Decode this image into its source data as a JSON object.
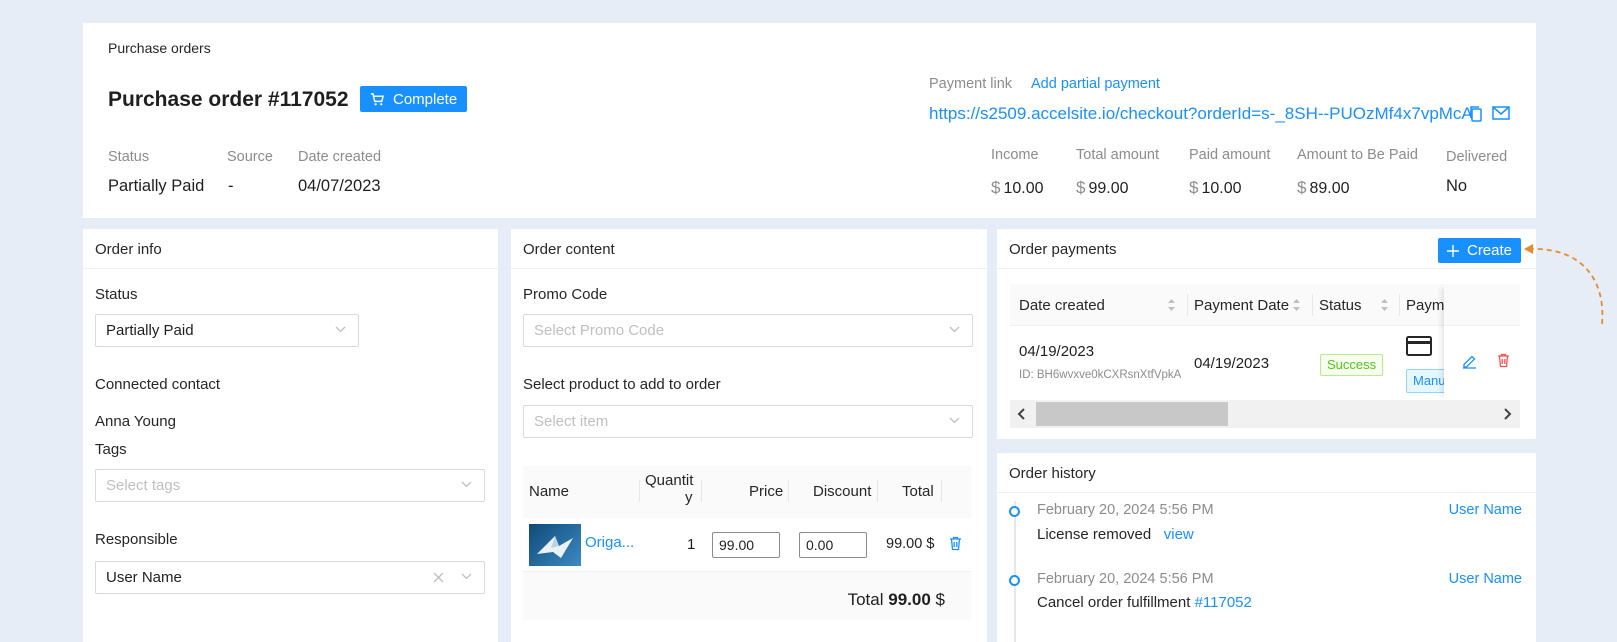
{
  "header": {
    "breadcrumb": "Purchase orders",
    "title": "Purchase order #117052",
    "complete_label": "Complete",
    "meta": {
      "status_label": "Status",
      "status_value": "Partially Paid",
      "source_label": "Source",
      "source_value": "-",
      "date_label": "Date created",
      "date_value": "04/07/2023"
    },
    "payment_link_label": "Payment link",
    "add_partial_label": "Add partial payment",
    "payment_url": "https://s2509.accelsite.io/checkout?orderId=s-_8SH--PUOzMf4x7vpMcA",
    "amounts": {
      "currency": "$",
      "income_label": "Income",
      "income_value": "10.00",
      "total_label": "Total amount",
      "total_value": "99.00",
      "paid_label": "Paid amount",
      "paid_value": "10.00",
      "due_label": "Amount to Be Paid",
      "due_value": "89.00",
      "delivered_label": "Delivered",
      "delivered_value": "No"
    }
  },
  "order_info": {
    "title": "Order info",
    "status_label": "Status",
    "status_value": "Partially Paid",
    "contact_label": "Connected contact",
    "contact_value": "Anna Young",
    "tags_label": "Tags",
    "tags_placeholder": "Select tags",
    "responsible_label": "Responsible",
    "responsible_value": "User Name"
  },
  "order_content": {
    "title": "Order content",
    "promo_label": "Promo Code",
    "promo_placeholder": "Select Promo Code",
    "product_label": "Select product to add to order",
    "product_placeholder": "Select item",
    "columns": {
      "name": "Name",
      "quantity_1": "Quantit",
      "quantity_2": "y",
      "price": "Price",
      "discount": "Discount",
      "total": "Total"
    },
    "rows": [
      {
        "name": "Origa...",
        "quantity": "1",
        "price": "99.00",
        "discount": "0.00",
        "total": "99.00",
        "currency": "$"
      }
    ],
    "total_label": "Total",
    "total_value": "99.00",
    "total_currency": "$"
  },
  "order_payments": {
    "title": "Order payments",
    "create_label": "Create",
    "columns": {
      "date_created": "Date created",
      "payment_date": "Payment Date",
      "status": "Status",
      "method": "Payme"
    },
    "rows": [
      {
        "date_created": "04/19/2023",
        "id": "ID: BH6wvxve0kCXRsnXtfVpkA",
        "payment_date": "04/19/2023",
        "status": "Success",
        "method_tag": "Manu"
      }
    ]
  },
  "order_history": {
    "title": "Order history",
    "entries": [
      {
        "time": "February 20, 2024 5:56 PM",
        "user": "User Name",
        "text": "License removed",
        "link": "view"
      },
      {
        "time": "February 20, 2024 5:56 PM",
        "user": "User Name",
        "text": "Cancel order fulfillment",
        "link": "#117052"
      }
    ]
  },
  "colors": {
    "accent": "#1890ff",
    "success": "#52c41a",
    "danger": "#ff4d4f",
    "annotation": "#e8892b"
  }
}
